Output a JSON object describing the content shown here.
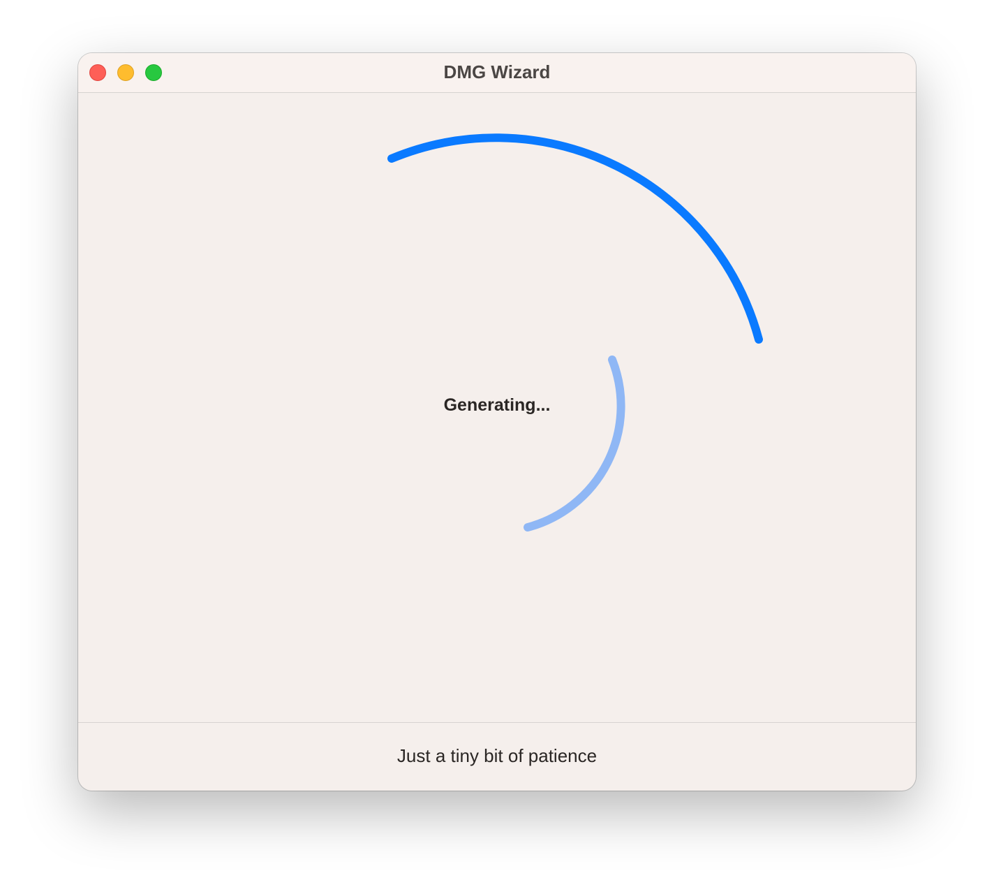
{
  "window": {
    "title": "DMG Wizard",
    "buttons": {
      "close": "close-button",
      "minimize": "minimize-button",
      "zoom": "zoom-button"
    }
  },
  "main": {
    "status": "Generating...",
    "spinner_colors": {
      "outer": "#0a7aff",
      "inner": "#8fb7f5"
    }
  },
  "footer": {
    "message": "Just a tiny bit of patience"
  }
}
